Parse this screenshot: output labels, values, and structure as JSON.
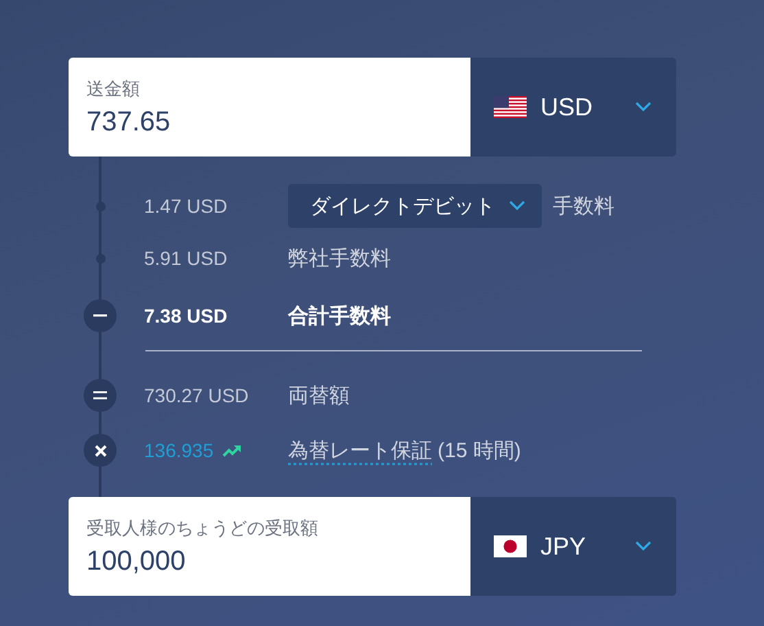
{
  "send": {
    "label": "送金額",
    "value": "737.65",
    "currency": "USD",
    "kind": "us"
  },
  "fees": [
    {
      "kind": "method",
      "amount": "1.47 USD",
      "method": "ダイレクトデビット",
      "label": "手数料"
    },
    {
      "kind": "plain",
      "amount": "5.91 USD",
      "label": "弊社手数料"
    },
    {
      "kind": "total",
      "amount": "7.38 USD",
      "label": "合計手数料"
    }
  ],
  "conversion": [
    {
      "kind": "amount",
      "amount": "730.27 USD",
      "label": "両替額"
    },
    {
      "kind": "rate",
      "amount": "136.935",
      "label": "為替レート保証",
      "note": "(15 時間)"
    }
  ],
  "receive": {
    "label": "受取人様のちょうどの受取額",
    "value": "100,000",
    "currency": "JPY",
    "kind": "jp"
  }
}
